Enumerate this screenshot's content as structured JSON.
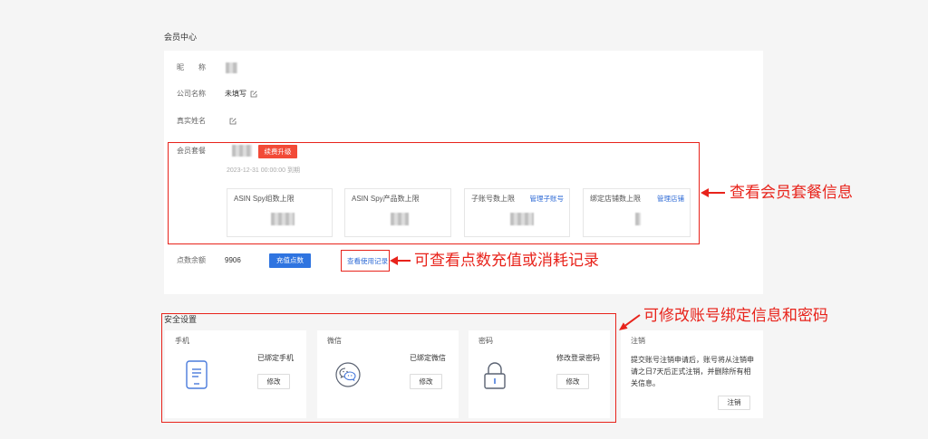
{
  "colors": {
    "page_bg": "#f5f5f5",
    "panel_bg": "#ffffff",
    "renew_button": "#f24a37",
    "primary_button": "#2f74e0",
    "link": "#2f6bd6",
    "annotation": "#e8231b",
    "icon": "#4a7bdc"
  },
  "member_center": {
    "title": "会员中心",
    "nickname": {
      "label": "昵　　称"
    },
    "company": {
      "label": "公司名称",
      "value": "未填写",
      "icon": "edit-icon"
    },
    "real_name": {
      "label": "真实姓名",
      "icon": "edit-icon"
    },
    "plan": {
      "label": "会员套餐",
      "renew_button": "续费升级",
      "expiry": "2023-12-31 00:00:00 到期",
      "quotas": [
        {
          "label": "ASIN Spy组数上限"
        },
        {
          "label": "ASIN Spy产品数上限"
        },
        {
          "label": "子账号数上限",
          "link": "管理子账号"
        },
        {
          "label": "绑定店铺数上限",
          "link": "管理店铺"
        }
      ]
    },
    "points": {
      "label": "点数余额",
      "value": "9906",
      "recharge_button": "充值点数",
      "usage_link": "查看使用记录"
    }
  },
  "security": {
    "title": "安全设置",
    "cards": [
      {
        "title": "手机",
        "icon": "phone-icon",
        "status": "已绑定手机",
        "button": "修改"
      },
      {
        "title": "微信",
        "icon": "wechat-icon",
        "status": "已绑定微信",
        "button": "修改"
      },
      {
        "title": "密码",
        "icon": "lock-icon",
        "status": "修改登录密码",
        "button": "修改"
      },
      {
        "title": "注销",
        "description": "提交账号注销申请后，账号将从注销申请之日7天后正式注销，并删除所有相关信息。",
        "button": "注销"
      }
    ]
  },
  "annotations": {
    "plan_note": "查看会员套餐信息",
    "points_note": "可查看点数充值或消耗记录",
    "security_note": "可修改账号绑定信息和密码"
  }
}
